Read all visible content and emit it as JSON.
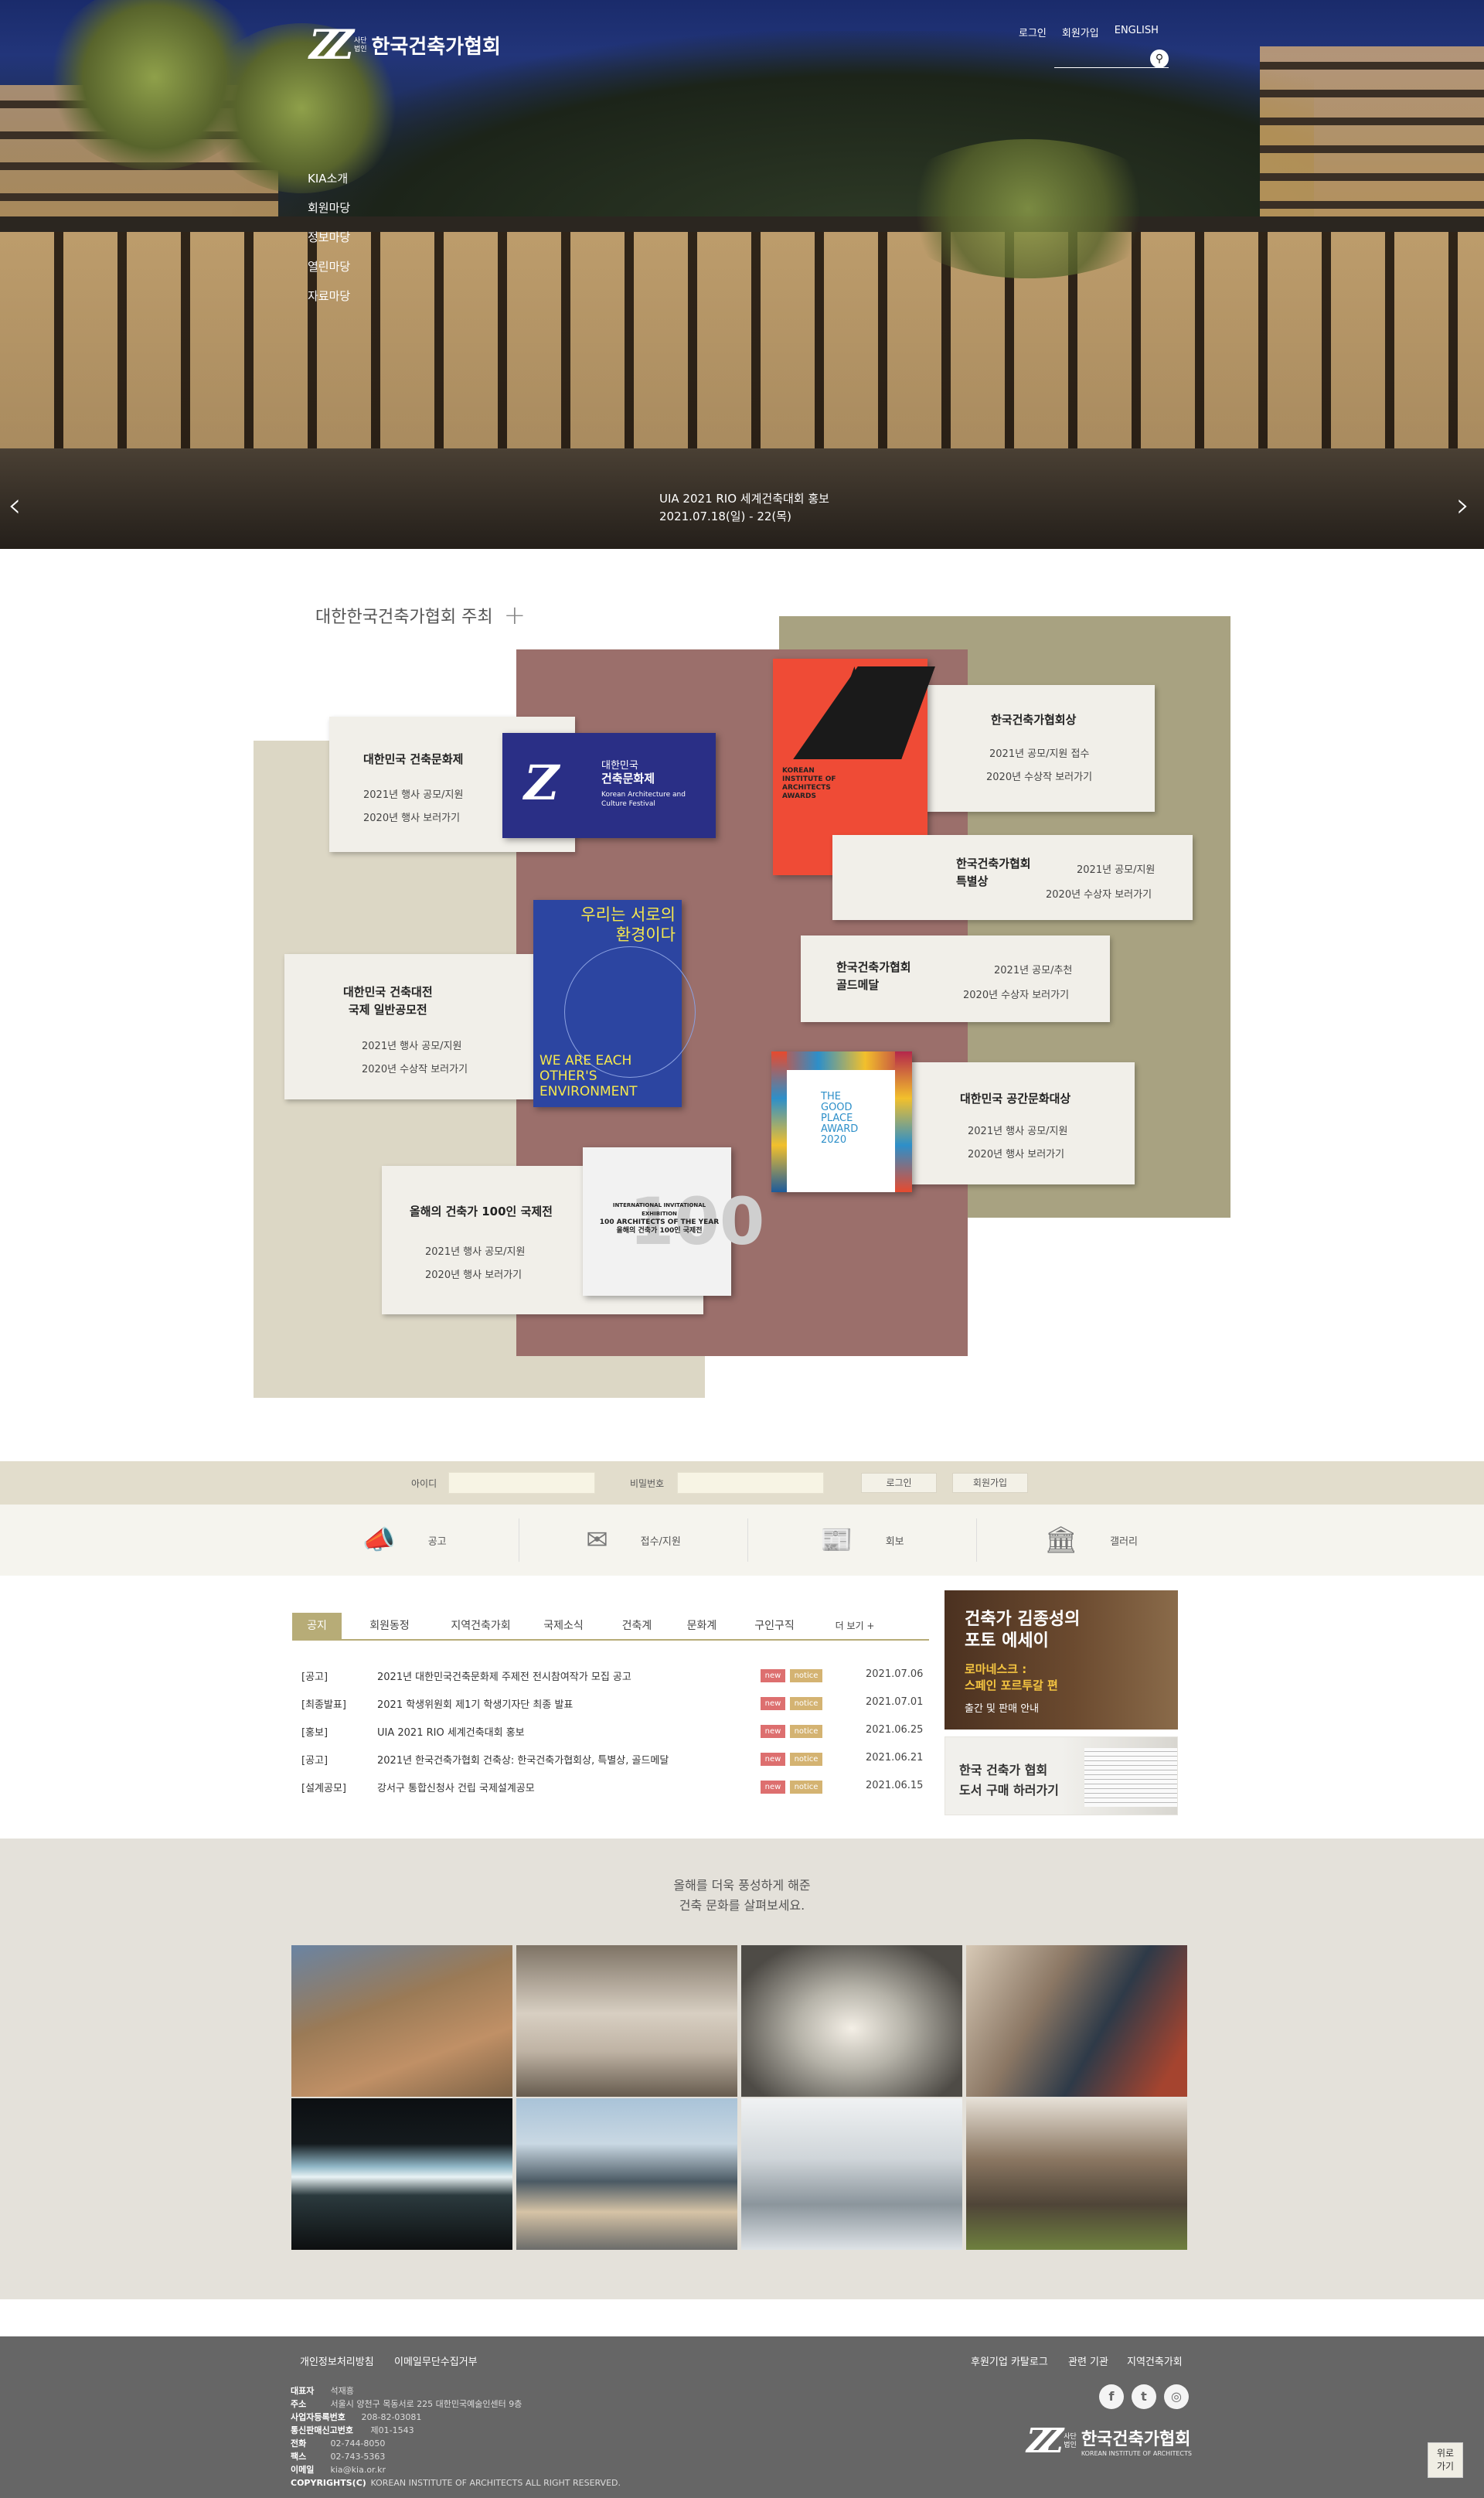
{
  "brand": {
    "logo_mark": "Z",
    "logo_sub1": "사단",
    "logo_sub2": "법인",
    "logo_name": "한국건축가협회",
    "logo_tag": "KOREAN INSTITUTE OF ARCHITECTS"
  },
  "topnav": {
    "login": "로그인",
    "join": "회원가입",
    "english": "ENGLISH"
  },
  "search": {
    "placeholder": "",
    "icon": "search-icon"
  },
  "gnb": [
    "KIA소개",
    "회원마당",
    "정보마당",
    "열린마당",
    "자료마당"
  ],
  "hero": {
    "caption_line1": "UIA 2021 RIO 세계건축대회 홍보",
    "caption_line2": "2021.07.18(일) - 22(목)",
    "prev": "‹",
    "next": "›"
  },
  "hosted": {
    "title": "대한한국건축가협회 주최",
    "plus": "+"
  },
  "cards": [
    {
      "title": "대한민국 건축문화제",
      "l1": "2021년 행사 공모/지원",
      "l2": "2020년 행사 보러가기"
    },
    {
      "title": "한국건축가협회상",
      "l1": "2021년 공모/지원 접수",
      "l2": "2020년 수상작 보러가기"
    },
    {
      "title": "한국건축가협회",
      "title2": "특별상",
      "l1": "2021년 공모/지원",
      "l2": "2020년 수상자 보러가기"
    },
    {
      "title": "대한민국 건축대전",
      "title2": "국제 일반공모전",
      "l1": "2021년 행사 공모/지원",
      "l2": "2020년 수상작 보러가기"
    },
    {
      "title": "한국건축가협회",
      "title2": "골드메달",
      "l1": "2021년 공모/추천",
      "l2": "2020년 수상자 보러가기"
    },
    {
      "title": "대한민국 공간문화대상",
      "l1": "2021년 행사 공모/지원",
      "l2": "2020년 행사 보러가기"
    },
    {
      "title": "올해의 건축가 100인 국제전",
      "l1": "2021년 행사 공모/지원",
      "l2": "2020년 행사 보러가기"
    }
  ],
  "posters": {
    "festival_kr1": "대한민국",
    "festival_kr2": "건축문화제",
    "festival_en1": "Korean Architecture and",
    "festival_en2": "Culture Festival",
    "kia_award": "KOREAN INSTITUTE OF ARCHITECTS AWARDS",
    "env_kr1": "우리는 서로의",
    "env_kr2": "환경이다",
    "env_en": "WE ARE EACH OTHER'S ENVIRONMENT",
    "good_place": "THE GOOD PLACE AWARD 2020",
    "arch100_en1": "INTERNATIONAL INVITATIONAL EXHIBITION",
    "arch100_en2": "100 ARCHITECTS OF THE YEAR",
    "arch100_kr": "올해의 건축가 100인 국제전",
    "arch100_big": "100"
  },
  "login": {
    "id_label": "아이디",
    "pw_label": "비밀번호",
    "login_btn": "로그인",
    "join_btn": "회원가입"
  },
  "quick": [
    {
      "label": "공고",
      "icon": "megaphone-icon"
    },
    {
      "label": "접수/지원",
      "icon": "submit-icon"
    },
    {
      "label": "회보",
      "icon": "newsletter-icon"
    },
    {
      "label": "갤러리",
      "icon": "gallery-icon"
    }
  ],
  "tabs": [
    "공지",
    "회원동정",
    "지역건축가회",
    "국제소식",
    "건축계",
    "문화계",
    "구인구직",
    "더 보기 +"
  ],
  "notices": [
    {
      "cat": "[공고]",
      "title": "2021년 대한민국건축문화제 주제전 전시참여작가 모집 공고",
      "b1": "new",
      "b2": "notice",
      "date": "2021.07.06"
    },
    {
      "cat": "[최종발표]",
      "title": "2021 학생위원회 제1기 학생기자단 최종 발표",
      "b1": "new",
      "b2": "notice",
      "date": "2021.07.01"
    },
    {
      "cat": "[홍보]",
      "title": "UIA 2021 RIO 세계건축대회 홍보",
      "b1": "new",
      "b2": "notice",
      "date": "2021.06.25"
    },
    {
      "cat": "[공고]",
      "title": "2021년 한국건축가협회 건축상: 한국건축가협회상, 특별상, 골드메달",
      "b1": "new",
      "b2": "notice",
      "date": "2021.06.21"
    },
    {
      "cat": "[설계공모]",
      "title": "강서구 통합신청사 건립 국제설계공모",
      "b1": "new",
      "b2": "notice",
      "date": "2021.06.15"
    }
  ],
  "ads": {
    "essay_l1": "건축가 김종성의",
    "essay_l2": "포토 에세이",
    "essay_l3": "로마네스크 :",
    "essay_l4": "스페인 포르투갈 편",
    "essay_l5": "출간 및 판매 안내",
    "book_l1": "한국 건축가 협회",
    "book_l2": "도서 구매 하러가기"
  },
  "gallery": {
    "line1": "올해를 더욱 풍성하게 해준",
    "line2": "건축 문화를 살펴보세요."
  },
  "footer": {
    "privacy": "개인정보처리방침",
    "email_policy": "이메일무단수집거부",
    "links": [
      "후원기업 카탈로그",
      "관련 기관",
      "지역건축가회"
    ],
    "info": [
      {
        "k": "대표자",
        "v": "석재흥"
      },
      {
        "k": "주소",
        "v": "서울시 양천구 목동서로 225 대한민국예술인센터 9층"
      },
      {
        "k": "사업자등록번호",
        "v": "208-82-03081"
      },
      {
        "k": "통신판매신고번호",
        "v": "제01-1543"
      },
      {
        "k": "전화",
        "v": "02-744-8050"
      },
      {
        "k": "팩스",
        "v": "02-743-5363"
      },
      {
        "k": "이메일",
        "v": "kia@kia.or.kr"
      },
      {
        "k": "COPYRIGHTS(C)",
        "v": "KOREAN INSTITUTE OF ARCHITECTS ALL RIGHT RESERVED."
      }
    ],
    "sns": [
      "f",
      "t",
      "◎"
    ],
    "top_l1": "위로",
    "top_l2": "가기"
  },
  "colors": {
    "accent": "#b7ac77",
    "tan": "#dcd7c5",
    "mauve": "#9b6f6b",
    "olive": "#a8a281",
    "footer": "#666666"
  }
}
